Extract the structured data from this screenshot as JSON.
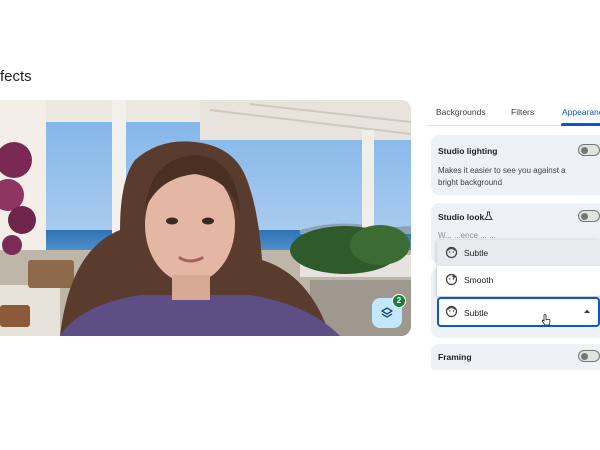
{
  "page": {
    "title": "fects"
  },
  "preview": {
    "effects_count": "2"
  },
  "tabs": [
    {
      "label": "Backgrounds",
      "active": false
    },
    {
      "label": "Filters",
      "active": false
    },
    {
      "label": "Appearanc",
      "active": true
    }
  ],
  "cards": {
    "studio_lighting": {
      "title": "Studio lighting",
      "description": "Makes it easier to see you against a bright background",
      "enabled": false
    },
    "studio_look": {
      "title": "Studio look",
      "obscured_text": "W... ...ence ... ...",
      "enabled": false
    },
    "framing": {
      "title": "Framing",
      "enabled": false
    }
  },
  "studio_look_dropdown": {
    "options": [
      {
        "label": "Subtle",
        "icon": "face-subtle-icon",
        "selected": true
      },
      {
        "label": "Smooth",
        "icon": "face-smooth-icon",
        "selected": false
      }
    ],
    "current_value": "Subtle"
  },
  "colors": {
    "accent": "#0b57d0",
    "card_bg": "#eef2f7",
    "badge": "#188038",
    "fab_bg": "#c2e7ff"
  }
}
